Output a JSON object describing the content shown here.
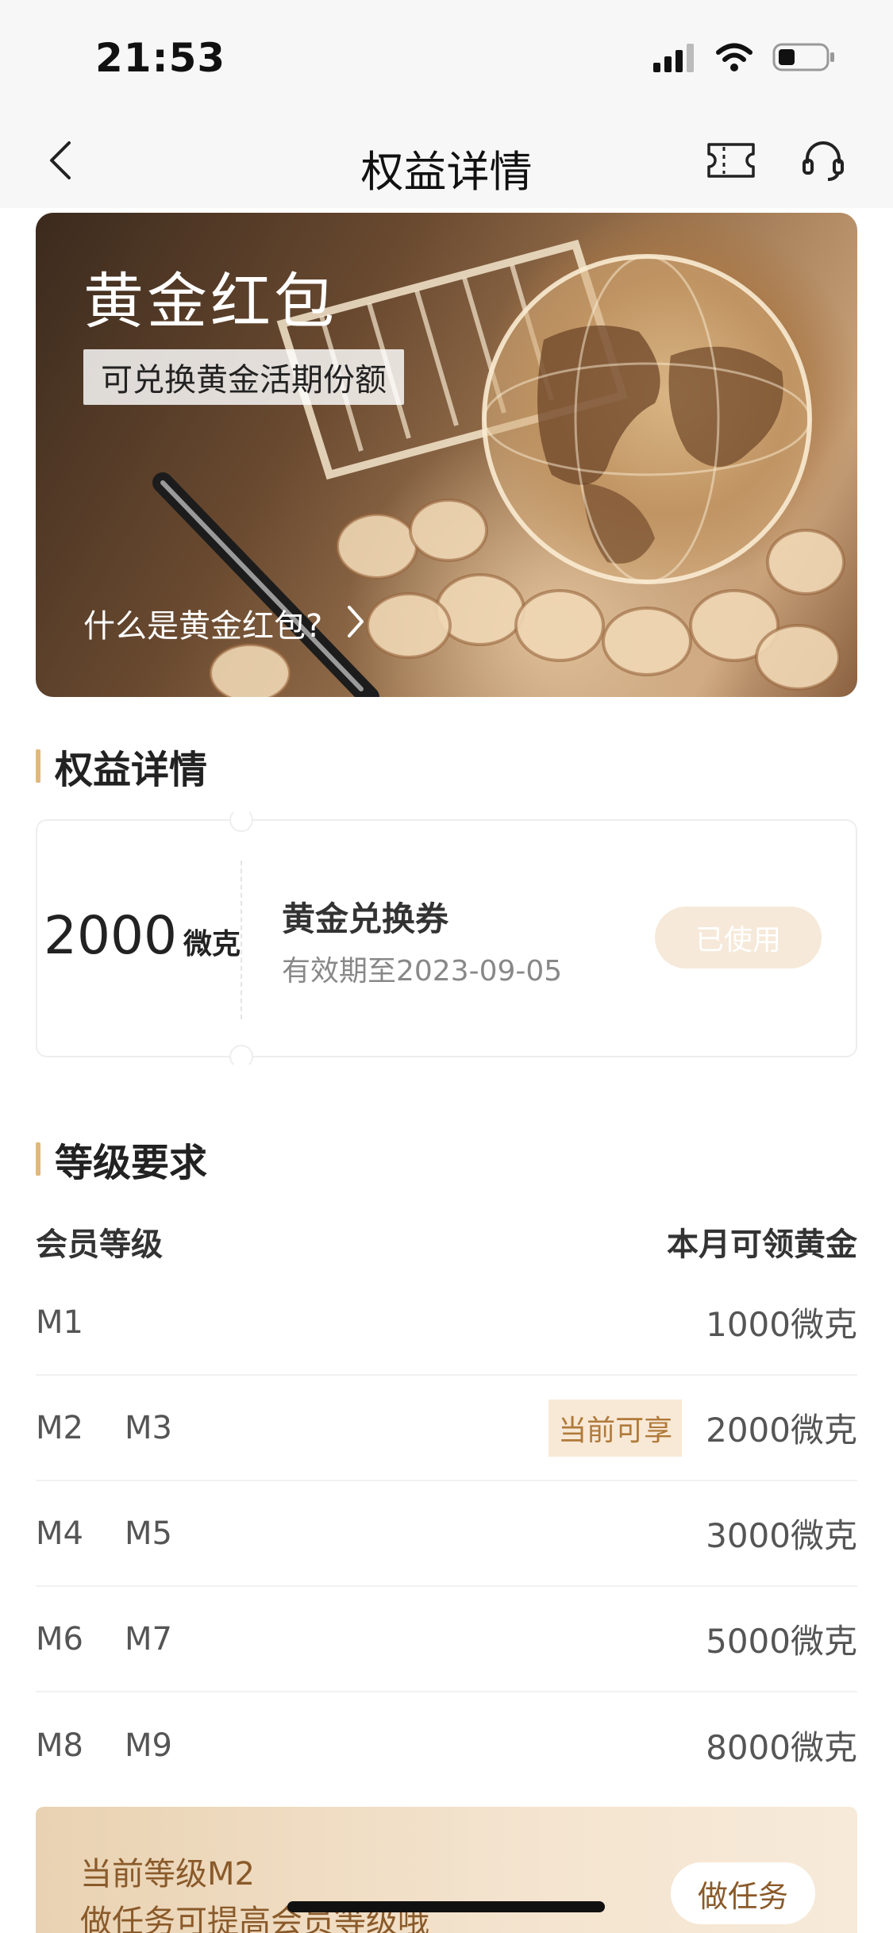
{
  "status_bar": {
    "time": "21:53"
  },
  "nav": {
    "title": "权益详情"
  },
  "banner": {
    "title": "黄金红包",
    "subtitle": "可兑换黄金活期份额",
    "link": "什么是黄金红包?"
  },
  "section_detail": {
    "title": "权益详情"
  },
  "coupon": {
    "value": "2000",
    "unit": "微克",
    "name": "黄金兑换券",
    "expiry": "有效期至2023-09-05",
    "button": "已使用"
  },
  "section_level": {
    "title": "等级要求"
  },
  "table": {
    "col_left": "会员等级",
    "col_right": "本月可领黄金",
    "rows": [
      {
        "level_a": "M1",
        "level_b": "",
        "badge": "",
        "amount": "1000微克"
      },
      {
        "level_a": "M2",
        "level_b": "M3",
        "badge": "当前可享",
        "amount": "2000微克"
      },
      {
        "level_a": "M4",
        "level_b": "M5",
        "badge": "",
        "amount": "3000微克"
      },
      {
        "level_a": "M6",
        "level_b": "M7",
        "badge": "",
        "amount": "5000微克"
      },
      {
        "level_a": "M8",
        "level_b": "M9",
        "badge": "",
        "amount": "8000微克"
      }
    ]
  },
  "promo": {
    "line1": "当前等级M2",
    "line2": "做任务可提高会员等级哦",
    "button": "做任务"
  }
}
